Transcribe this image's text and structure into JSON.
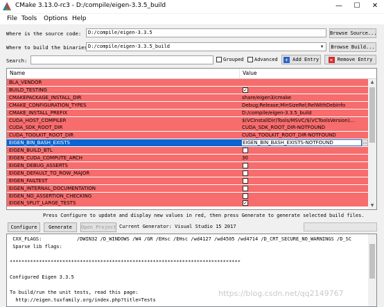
{
  "window": {
    "title": "CMake 3.13.0-rc3 - D:/compile/eigen-3.3.5_build",
    "minimize": "—",
    "maximize": "☐",
    "close": "✕"
  },
  "menu": [
    "File",
    "Tools",
    "Options",
    "Help"
  ],
  "source": {
    "label": "Where is the source code:",
    "value": "D:/compile/eigen-3.3.5",
    "button": "Browse Source..."
  },
  "build": {
    "label": "Where to build the binaries:",
    "value": "D:/compile/eigen-3.3.5_build",
    "button": "Browse Build..."
  },
  "search": {
    "label": "Search:",
    "value": "",
    "grouped": "Grouped",
    "advanced": "Advanced",
    "add_entry": "Add Entry",
    "remove_entry": "Remove Entry"
  },
  "table": {
    "col_name": "Name",
    "col_value": "Value",
    "rows": [
      {
        "name": "BLA_VENDOR",
        "type": "text",
        "value": ""
      },
      {
        "name": "BUILD_TESTING",
        "type": "bool",
        "checked": true
      },
      {
        "name": "CMAKEPACKAGE_INSTALL_DIR",
        "type": "text",
        "value": "share/eigen3/cmake"
      },
      {
        "name": "CMAKE_CONFIGURATION_TYPES",
        "type": "text",
        "value": "Debug;Release;MinSizeRel;RelWithDebInfo"
      },
      {
        "name": "CMAKE_INSTALL_PREFIX",
        "type": "text",
        "value": "D:/compile/eigen-3.3.5_build"
      },
      {
        "name": "CUDA_HOST_COMPILER",
        "type": "text",
        "value": "$(VCInstallDir)Tools/MSVC/$(VCToolsVersion)..."
      },
      {
        "name": "CUDA_SDK_ROOT_DIR",
        "type": "text",
        "value": "CUDA_SDK_ROOT_DIR-NOTFOUND"
      },
      {
        "name": "CUDA_TOOLKIT_ROOT_DIR",
        "type": "text",
        "value": "CUDA_TOOLKIT_ROOT_DIR-NOTFOUND"
      },
      {
        "name": "EIGEN_BIN_BASH_EXISTS",
        "type": "edit",
        "value": "EIGEN_BIN_BASH_EXISTS-NOTFOUND",
        "selected": true
      },
      {
        "name": "EIGEN_BUILD_BTL",
        "type": "bool",
        "checked": false
      },
      {
        "name": "EIGEN_CUDA_COMPUTE_ARCH",
        "type": "text",
        "value": "30"
      },
      {
        "name": "EIGEN_DEBUG_ASSERTS",
        "type": "bool",
        "checked": false
      },
      {
        "name": "EIGEN_DEFAULT_TO_ROW_MAJOR",
        "type": "bool",
        "checked": false
      },
      {
        "name": "EIGEN_FAILTEST",
        "type": "bool",
        "checked": false
      },
      {
        "name": "EIGEN_INTERNAL_DOCUMENTATION",
        "type": "bool",
        "checked": false
      },
      {
        "name": "EIGEN_NO_ASSERTION_CHECKING",
        "type": "bool",
        "checked": false
      },
      {
        "name": "EIGEN_SPLIT_LARGE_TESTS",
        "type": "bool",
        "checked": true
      }
    ]
  },
  "hint": "Press Configure to update and display new values in red, then press Generate to generate selected build files.",
  "actions": {
    "configure": "Configure",
    "generate": "Generate",
    "open_project": "Open Project",
    "current_generator": "Current Generator: Visual Studio 15 2017"
  },
  "output": [
    " CXX_FLAGS:            /DWIN32 /D_WINDOWS /W4 /GR /EHsc /EHsc /wd4127 /wd4505 /wd4714 /D_CRT_SECURE_NO_WARNINGS /D_SC",
    " Sparse lib flags:",
    "",
    "*******************************************************************************",
    "",
    "Configured Eigen 3.3.5",
    "",
    "To build/run the unit tests, read this page:",
    "  http://eigen.tuxfamily.org/index.php?title=Tests"
  ],
  "watermark": "https://blog.csdn.net/qq2149767"
}
